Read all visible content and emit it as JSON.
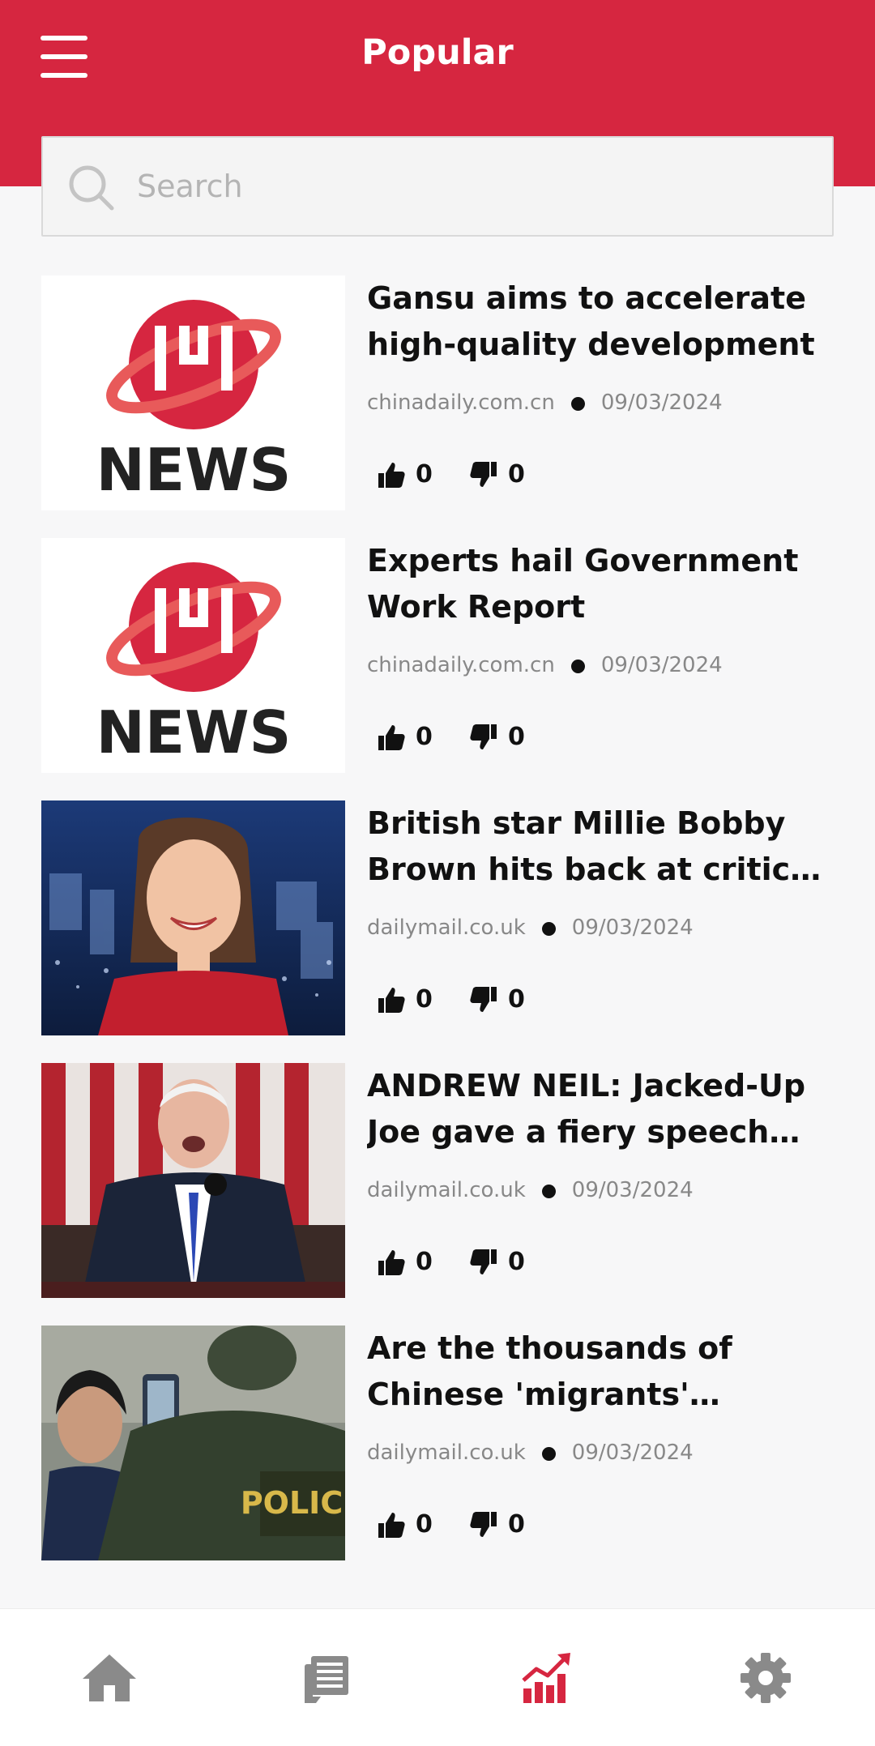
{
  "header": {
    "title": "Popular",
    "background": "#d62640"
  },
  "search": {
    "placeholder": "Search",
    "value": ""
  },
  "articles": [
    {
      "headline": "Gansu aims to accelerate high-quality development",
      "source": "chinadaily.com.cn",
      "date": "09/03/2024",
      "likes": "0",
      "dislikes": "0",
      "thumbnail": "news-logo"
    },
    {
      "headline": "Experts hail Government Work Report",
      "source": "chinadaily.com.cn",
      "date": "09/03/2024",
      "likes": "0",
      "dislikes": "0",
      "thumbnail": "news-logo"
    },
    {
      "headline": "British star Millie Bobby Brown hits back at critics ...",
      "source": "dailymail.co.uk",
      "date": "09/03/2024",
      "likes": "0",
      "dislikes": "0",
      "thumbnail": "photo-woman-smiling"
    },
    {
      "headline": "ANDREW NEIL: Jacked-Up Joe gave a fiery speech b...",
      "source": "dailymail.co.uk",
      "date": "09/03/2024",
      "likes": "0",
      "dislikes": "0",
      "thumbnail": "photo-man-speech"
    },
    {
      "headline": "Are the thousands of Chinese 'migrants' floodin...",
      "source": "dailymail.co.uk",
      "date": "09/03/2024",
      "likes": "0",
      "dislikes": "0",
      "thumbnail": "photo-border-police"
    }
  ],
  "logo_text": {
    "mark": "IHI",
    "word": "NEWS"
  },
  "bottom_nav": [
    {
      "name": "home",
      "icon": "home-icon",
      "active": false
    },
    {
      "name": "articles",
      "icon": "newspaper-icon",
      "active": false
    },
    {
      "name": "popular",
      "icon": "trending-chart-icon",
      "active": true
    },
    {
      "name": "settings",
      "icon": "gear-icon",
      "active": false
    }
  ],
  "colors": {
    "accent": "#d62640",
    "nav_inactive": "#8a8a8a",
    "text": "#111111",
    "meta_text": "#888888"
  }
}
